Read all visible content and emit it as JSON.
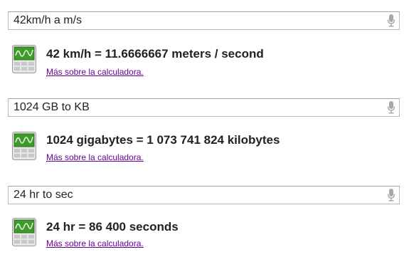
{
  "colors": {
    "link": "#660099",
    "text": "#222222",
    "search_border": "#b9b9b9",
    "icon_green": "#3f9a2c"
  },
  "icons": {
    "mic": "microphone-icon",
    "calculator": "calculator-icon"
  },
  "results": [
    {
      "query": "42km/h a m/s",
      "answer": "42 km/h = 11.6666667 meters / second",
      "link": "Más sobre la calculadora."
    },
    {
      "query": "1024 GB to KB",
      "answer": "1024 gigabytes = 1 073 741 824 kilobytes",
      "link": "Más sobre la calculadora."
    },
    {
      "query": "24 hr to sec",
      "answer": "24 hr = 86 400 seconds",
      "link": "Más sobre la calculadora."
    }
  ]
}
